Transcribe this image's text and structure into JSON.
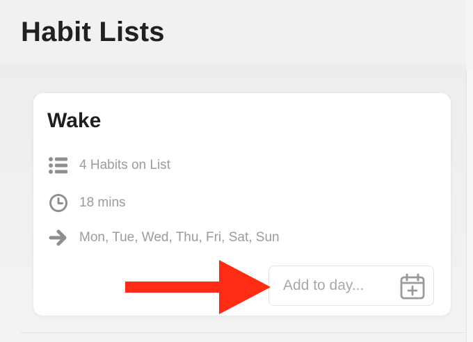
{
  "page": {
    "title": "Habit Lists"
  },
  "card": {
    "title": "Wake",
    "habits_count_text": "4 Habits on List",
    "duration_text": "18 mins",
    "days_text": "Mon, Tue, Wed, Thu, Fri, Sat, Sun",
    "add_to_day_placeholder": "Add to day..."
  },
  "icons": {
    "habits_count": "list-icon",
    "duration": "clock-icon",
    "days": "arrow-right-icon",
    "add_to_day": "calendar-plus-icon",
    "overlay": "red-arrow-icon"
  },
  "colors": {
    "background": "#f1f1f1",
    "card_background": "#ffffff",
    "title_text": "#202020",
    "meta_text": "#9b9b9b",
    "icon_gray": "#8f8f8f",
    "input_border": "#e3e3e3",
    "overlay_arrow": "#ff2b12"
  }
}
